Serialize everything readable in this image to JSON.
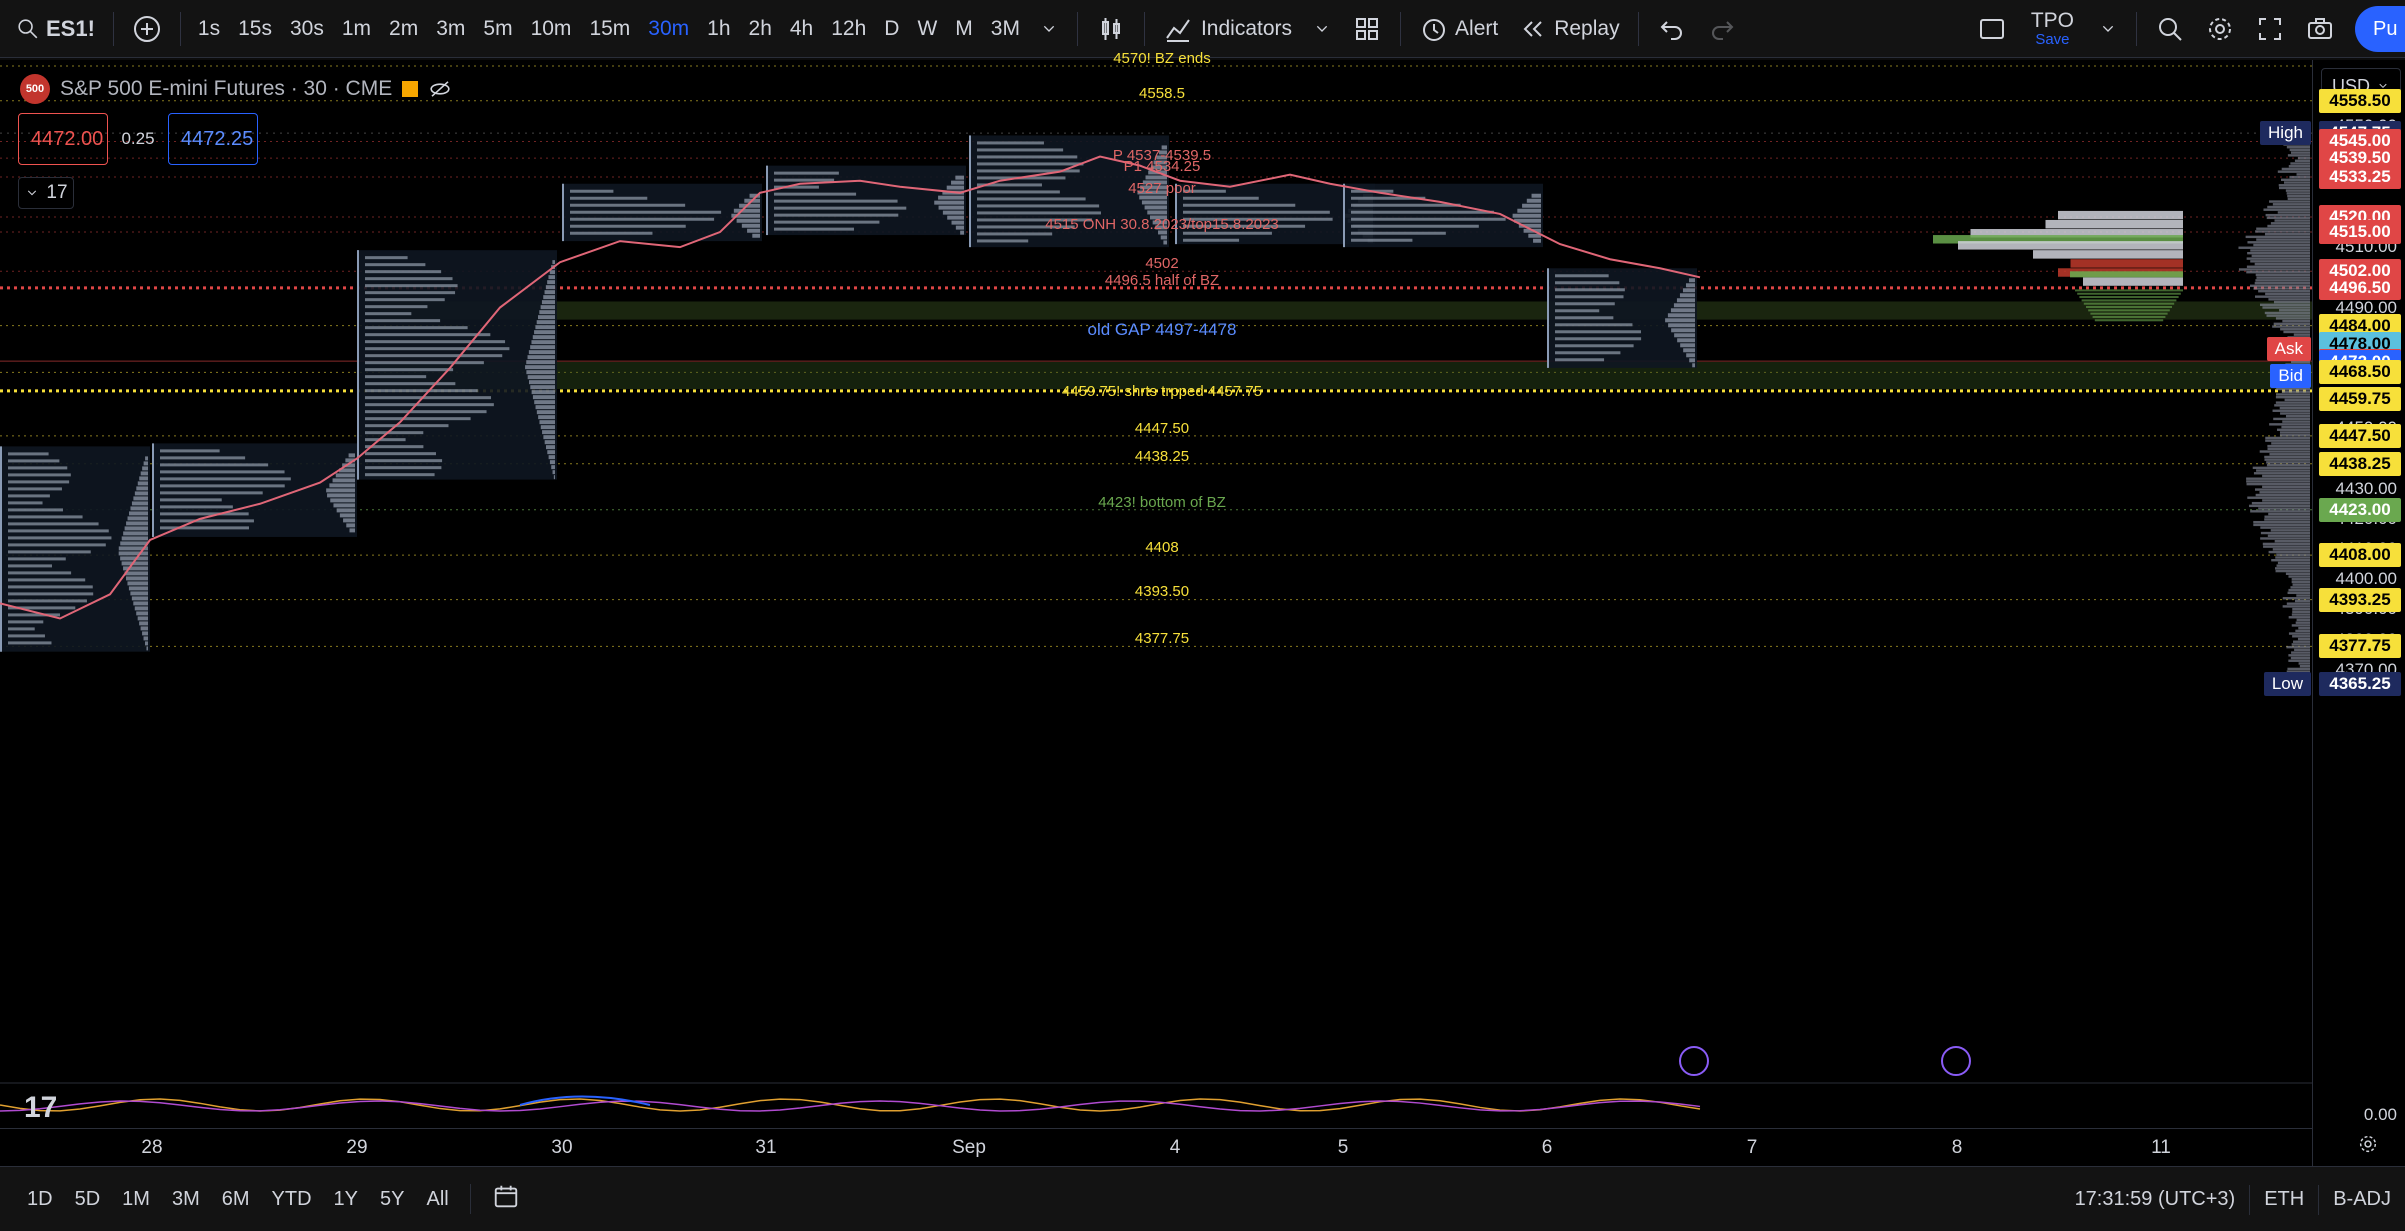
{
  "toolbar": {
    "symbol": "ES1!",
    "intervals": [
      "1s",
      "15s",
      "30s",
      "1m",
      "2m",
      "3m",
      "5m",
      "10m",
      "15m",
      "30m",
      "1h",
      "2h",
      "4h",
      "12h",
      "D",
      "W",
      "M",
      "3M"
    ],
    "active_interval": "30m",
    "indicators_label": "Indicators",
    "alert_label": "Alert",
    "replay_label": "Replay",
    "layout_name": "TPO",
    "layout_save": "Save",
    "publish_label": "Pu"
  },
  "legend": {
    "logo_text": "500",
    "title": "S&P 500 E-mini Futures · 30 · CME",
    "sell_price": "4472.00",
    "spread": "0.25",
    "buy_price": "4472.25",
    "collapsed_count": "17"
  },
  "price_scale": {
    "currency": "USD",
    "ticks": [
      "4550.00",
      "4510.00",
      "4490.00",
      "4470.00",
      "4460.00",
      "4450.00",
      "4430.00",
      "4420.00",
      "4410.00",
      "4400.00",
      "4390.00",
      "4380.00",
      "4370.00",
      "0.00"
    ],
    "labels": [
      {
        "price": "4558.50",
        "bg": "#f7e03a",
        "fg": "#000"
      },
      {
        "price": "4547.75",
        "bg": "#1e2a5e",
        "fg": "#fff"
      },
      {
        "price": "4545.00",
        "bg": "#e04646",
        "fg": "#fff"
      },
      {
        "price": "4539.50",
        "bg": "#e04646",
        "fg": "#fff"
      },
      {
        "price": "4533.25",
        "bg": "#e04646",
        "fg": "#fff"
      },
      {
        "price": "4520.00",
        "bg": "#e04646",
        "fg": "#fff"
      },
      {
        "price": "4515.00",
        "bg": "#e04646",
        "fg": "#fff"
      },
      {
        "price": "4502.00",
        "bg": "#e04646",
        "fg": "#fff"
      },
      {
        "price": "4496.50",
        "bg": "#e04646",
        "fg": "#fff"
      },
      {
        "price": "4484.00",
        "bg": "#f7e03a",
        "fg": "#000"
      },
      {
        "price": "4478.00",
        "bg": "#5bc0de",
        "fg": "#000"
      },
      {
        "price": "4472.25",
        "bg": "#e04646",
        "fg": "#fff"
      },
      {
        "price": "4472.00",
        "bg": "#2962ff",
        "fg": "#fff"
      },
      {
        "price": "4468.50",
        "bg": "#f7e03a",
        "fg": "#000"
      },
      {
        "price": "4459.75",
        "bg": "#f7e03a",
        "fg": "#000"
      },
      {
        "price": "4447.50",
        "bg": "#f7e03a",
        "fg": "#000"
      },
      {
        "price": "4438.25",
        "bg": "#f7e03a",
        "fg": "#000"
      },
      {
        "price": "4423.00",
        "bg": "#6aa84f",
        "fg": "#fff"
      },
      {
        "price": "4408.00",
        "bg": "#f7e03a",
        "fg": "#000"
      },
      {
        "price": "4393.25",
        "bg": "#f7e03a",
        "fg": "#000"
      },
      {
        "price": "4377.75",
        "bg": "#f7e03a",
        "fg": "#000"
      },
      {
        "price": "4365.25",
        "bg": "#1e2a5e",
        "fg": "#fff"
      }
    ],
    "high_tag": "High",
    "low_tag": "Low",
    "ask_tag": "Ask",
    "bid_tag": "Bid"
  },
  "annotations": [
    {
      "text": "4570! BZ ends",
      "color": "#f7e03a"
    },
    {
      "text": "4558.5",
      "color": "#f7e03a"
    },
    {
      "text": "P 4537-4539.5",
      "color": "#e06666"
    },
    {
      "text": "P1 4534.25",
      "color": "#e06666"
    },
    {
      "text": "4527 poor",
      "color": "#e06666"
    },
    {
      "text": "4515 ONH 30.8.2023/top15.8.2023",
      "color": "#e06666"
    },
    {
      "text": "4502",
      "color": "#e06666"
    },
    {
      "text": "4496.5 half of BZ",
      "color": "#e06666"
    },
    {
      "text": "old GAP 4497-4478",
      "color": "#5b8cff"
    },
    {
      "text": "4459.75! shrts trpped 4457.75",
      "color": "#f7e03a"
    },
    {
      "text": "4447.50",
      "color": "#f7e03a"
    },
    {
      "text": "4438.25",
      "color": "#f7e03a"
    },
    {
      "text": "4423! bottom of BZ",
      "color": "#6aa84f"
    },
    {
      "text": "4408",
      "color": "#f7e03a"
    },
    {
      "text": "4393.50",
      "color": "#f7e03a"
    },
    {
      "text": "4377.75",
      "color": "#f7e03a"
    }
  ],
  "time_axis": [
    "28",
    "29",
    "30",
    "31",
    "Sep",
    "4",
    "5",
    "6",
    "7",
    "8",
    "11"
  ],
  "bottombar": {
    "ranges": [
      "1D",
      "5D",
      "1M",
      "3M",
      "6M",
      "YTD",
      "1Y",
      "5Y",
      "All"
    ],
    "clock": "17:31:59 (UTC+3)",
    "session": "ETH",
    "adjustment": "B-ADJ"
  },
  "colors": {
    "background": "#000000",
    "accent": "#2962ff",
    "yellow_line": "#f7e03a",
    "red_line": "#e04646"
  }
}
